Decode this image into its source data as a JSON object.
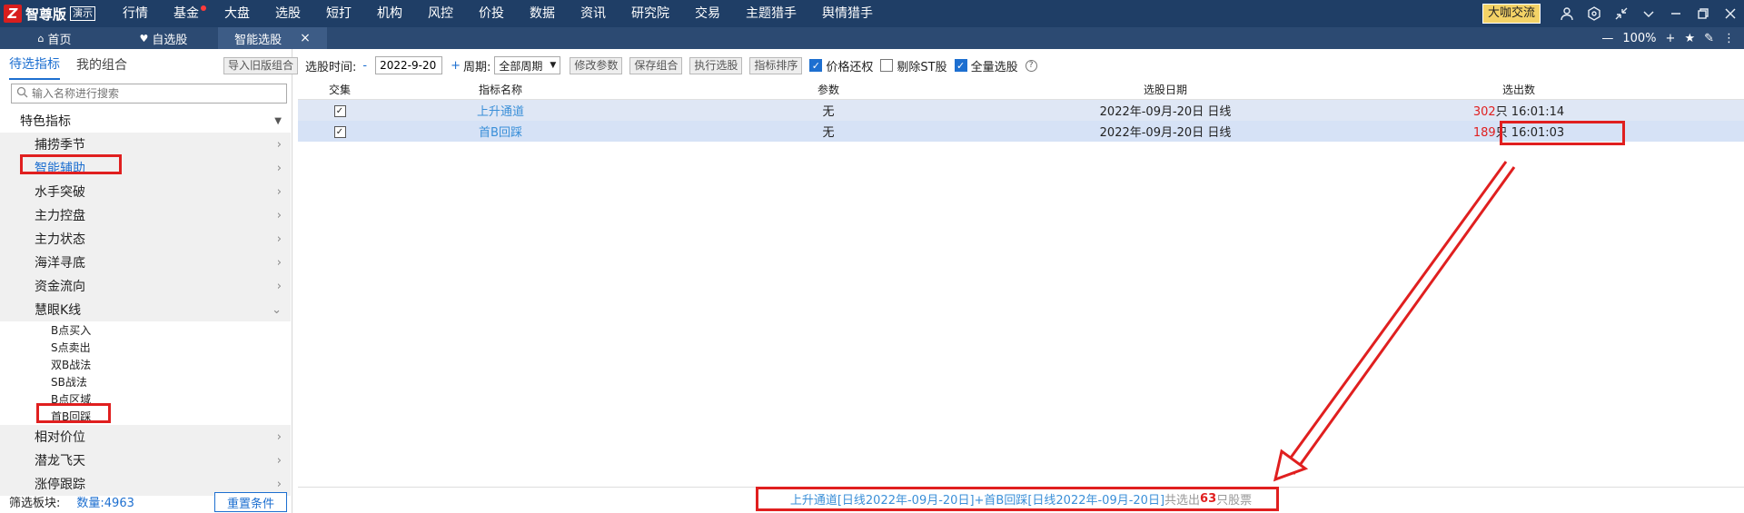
{
  "app": {
    "logo_badge": "Z",
    "logo_text": "智尊版",
    "demo_label": "演示"
  },
  "menu": {
    "items": [
      "行情",
      "基金",
      "大盘",
      "选股",
      "短打",
      "机构",
      "风控",
      "价投",
      "数据",
      "资讯",
      "研究院",
      "交易",
      "主题猎手",
      "舆情猎手"
    ],
    "community": "大咖交流"
  },
  "tabs": {
    "home": "首页",
    "favorites": "自选股",
    "smart": "智能选股",
    "close": "×",
    "zoom": "100%"
  },
  "left": {
    "tab_active": "待选指标",
    "tab_other": "我的组合",
    "search_placeholder": "输入名称进行搜索",
    "category": "特色指标",
    "groups_top": [
      "捕捞季节",
      "智能辅助",
      "水手突破",
      "主力控盘",
      "主力状态",
      "海洋寻底",
      "资金流向",
      "慧眼K线"
    ],
    "subitems": [
      "B点买入",
      "S点卖出",
      "双B战法",
      "SB战法",
      "B点区域",
      "首B回踩"
    ],
    "groups_bottom": [
      "相对价位",
      "潜龙飞天",
      "涨停跟踪"
    ],
    "footer_label": "筛选板块:",
    "footer_count": "数量:4963",
    "reset": "重置条件"
  },
  "toolbar": {
    "import": "导入旧版组合",
    "time_label": "选股时间:",
    "minus": "-",
    "date": "2022-9-20",
    "plus": "+",
    "period_label": "周期:",
    "period_value": "全部周期",
    "modify": "修改参数",
    "save": "保存组合",
    "execute": "执行选股",
    "sort": "指标排序",
    "price_restore": "价格还权",
    "remove_st": "剔除ST股",
    "all_stocks": "全量选股",
    "help": "?"
  },
  "table": {
    "headers": [
      "交集",
      "指标名称",
      "参数",
      "选股日期",
      "选出数"
    ],
    "rows": [
      {
        "name": "上升通道",
        "param": "无",
        "date": "2022年-09月-20日 日线",
        "count": "302",
        "unit": "只",
        "time": "16:01:14"
      },
      {
        "name": "首B回踩",
        "param": "无",
        "date": "2022年-09月-20日 日线",
        "count": "189",
        "unit": "只",
        "time": "16:01:03"
      }
    ]
  },
  "result": {
    "expr": "上升通道[日线2022年-09月-20日]+首B回踩[日线2022年-09月-20日]",
    "prefix": " 共选出",
    "count": "63",
    "suffix": "只股票"
  }
}
